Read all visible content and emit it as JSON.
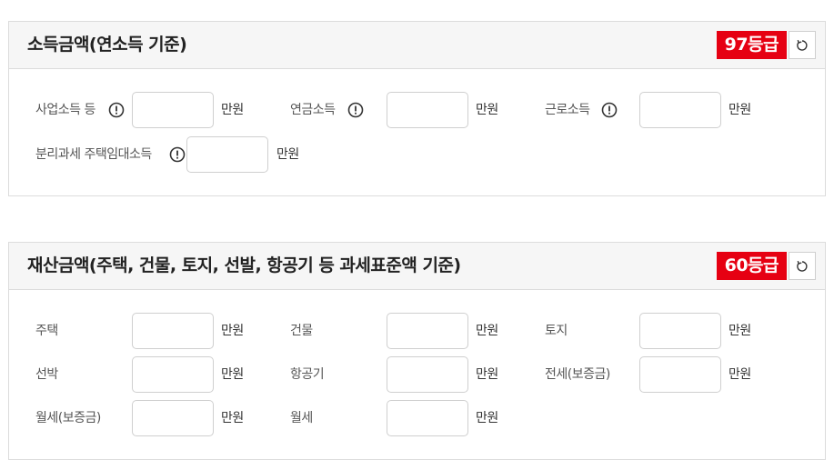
{
  "income": {
    "title": "소득금액(연소득 기준)",
    "grade": "97등급",
    "fields": [
      {
        "label": "사업소득 등",
        "unit": "만원",
        "value": ""
      },
      {
        "label": "연금소득",
        "unit": "만원",
        "value": ""
      },
      {
        "label": "근로소득",
        "unit": "만원",
        "value": ""
      },
      {
        "label": "분리과세 주택임대소득",
        "unit": "만원",
        "value": ""
      }
    ]
  },
  "property": {
    "title": "재산금액(주택, 건물, 토지, 선발, 항공기 등 과세표준액 기준)",
    "grade": "60등급",
    "fields": [
      {
        "label": "주택",
        "unit": "만원",
        "value": ""
      },
      {
        "label": "건물",
        "unit": "만원",
        "value": ""
      },
      {
        "label": "토지",
        "unit": "만원",
        "value": ""
      },
      {
        "label": "선박",
        "unit": "만원",
        "value": ""
      },
      {
        "label": "항공기",
        "unit": "만원",
        "value": ""
      },
      {
        "label": "전세(보증금)",
        "unit": "만원",
        "value": ""
      },
      {
        "label": "월세(보증금)",
        "unit": "만원",
        "value": ""
      },
      {
        "label": "월세",
        "unit": "만원",
        "value": ""
      }
    ]
  },
  "colors": {
    "grade_badge": "#e60012",
    "header_bg": "#f6f6f6"
  },
  "icons": {
    "info": "info-circle-icon",
    "reset": "refresh-icon"
  }
}
